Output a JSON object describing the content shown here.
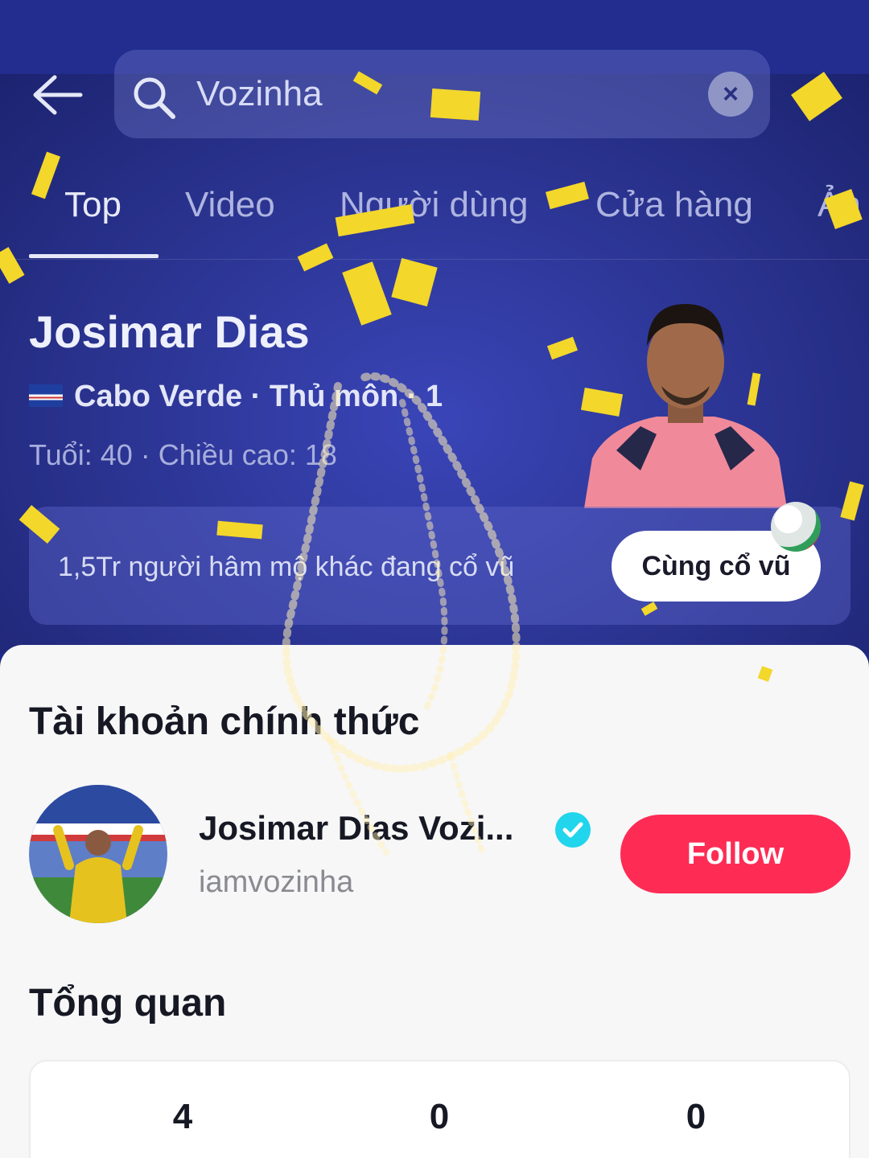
{
  "search": {
    "query": "Vozinha"
  },
  "tabs": [
    {
      "label": "Top",
      "active": true
    },
    {
      "label": "Video",
      "active": false
    },
    {
      "label": "Người dùng",
      "active": false
    },
    {
      "label": "Cửa hàng",
      "active": false
    },
    {
      "label": "Ản",
      "active": false
    }
  ],
  "player": {
    "name": "Josimar Dias",
    "team_line": "Cabo Verde · Thủ môn · 1",
    "stats_line": "Tuổi: 40 · Chiều cao: 18",
    "fans_text": "1,5Tr người hâm mộ khác đang cổ vũ",
    "cheer_button": "Cùng cổ vũ"
  },
  "official": {
    "title": "Tài khoản chính thức",
    "name": "Josimar Dias Vozi...",
    "handle": "iamvozinha",
    "follow_label": "Follow"
  },
  "overview": {
    "title": "Tổng quan",
    "stats": [
      "4",
      "0",
      "0"
    ]
  },
  "colors": {
    "hero_bg": "#2a338f",
    "follow": "#fe2c55",
    "confetti": "#f3d72a",
    "verified": "#20d5ec"
  }
}
